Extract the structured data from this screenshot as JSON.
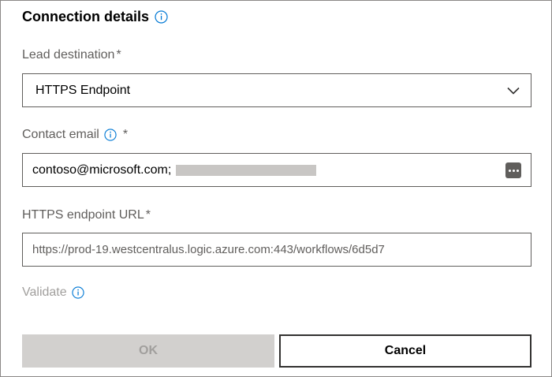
{
  "header": {
    "title": "Connection details",
    "info_icon": "info-icon"
  },
  "lead_destination": {
    "label": "Lead destination",
    "required_mark": "*",
    "value": "HTTPS Endpoint",
    "icon": "chevron-down-icon"
  },
  "contact_email": {
    "label": "Contact email",
    "required_mark": "*",
    "info_icon": "info-icon",
    "value": "contoso@microsoft.com;",
    "action_icon": "more-icon"
  },
  "https_endpoint": {
    "label": "HTTPS endpoint URL",
    "required_mark": "*",
    "value": "https://prod-19.westcentralus.logic.azure.com:443/workflows/6d5d7"
  },
  "validate": {
    "label": "Validate",
    "info_icon": "info-icon"
  },
  "buttons": {
    "ok": "OK",
    "cancel": "Cancel"
  },
  "colors": {
    "accent": "#0078d4",
    "border": "#605e5c",
    "disabled_bg": "#d2d0ce",
    "disabled_text": "#a19f9d"
  }
}
